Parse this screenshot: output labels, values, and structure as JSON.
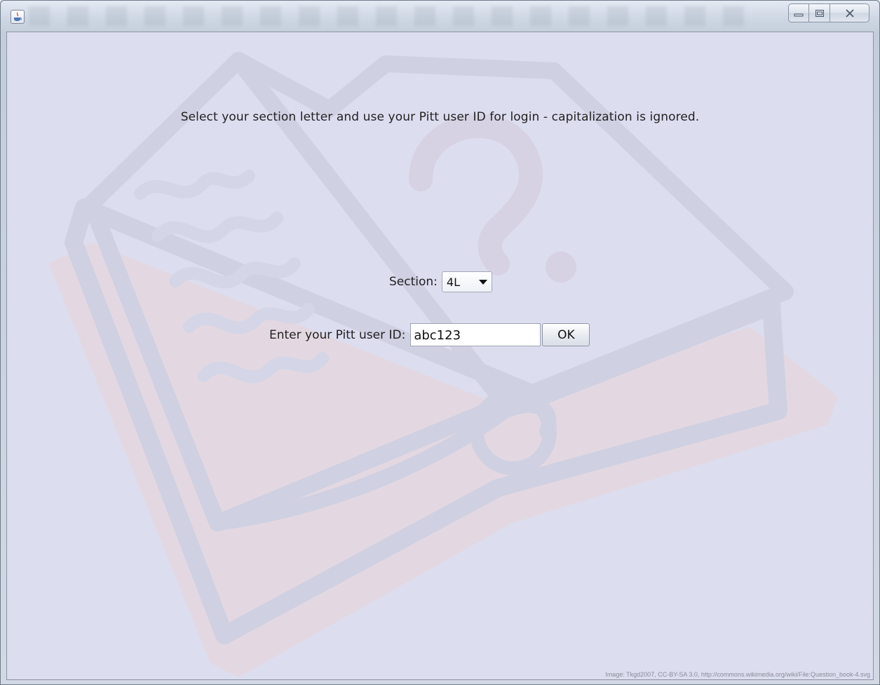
{
  "window": {
    "app_icon": "java-coffee-icon",
    "controls": {
      "minimize": "minimize-icon",
      "maximize": "maximize-icon",
      "close": "close-icon"
    }
  },
  "form": {
    "instruction": "Select your section letter and use your Pitt user ID for login - capitalization is ignored.",
    "section_label": "Section:",
    "section_value": "4L",
    "user_id_label": "Enter your Pitt user ID:",
    "user_id_value": "abc123",
    "ok_label": "OK"
  },
  "background": {
    "image": "question-book-icon",
    "credit": "Image: Tkgd2007, CC-BY-SA 3.0, http://commons.wikimedia.org/wiki/File:Question_book-4.svg"
  },
  "colors": {
    "panel_background": "#dcddef",
    "book_outline": "#cfcfe0",
    "book_shadow": "#e6d3d6"
  }
}
